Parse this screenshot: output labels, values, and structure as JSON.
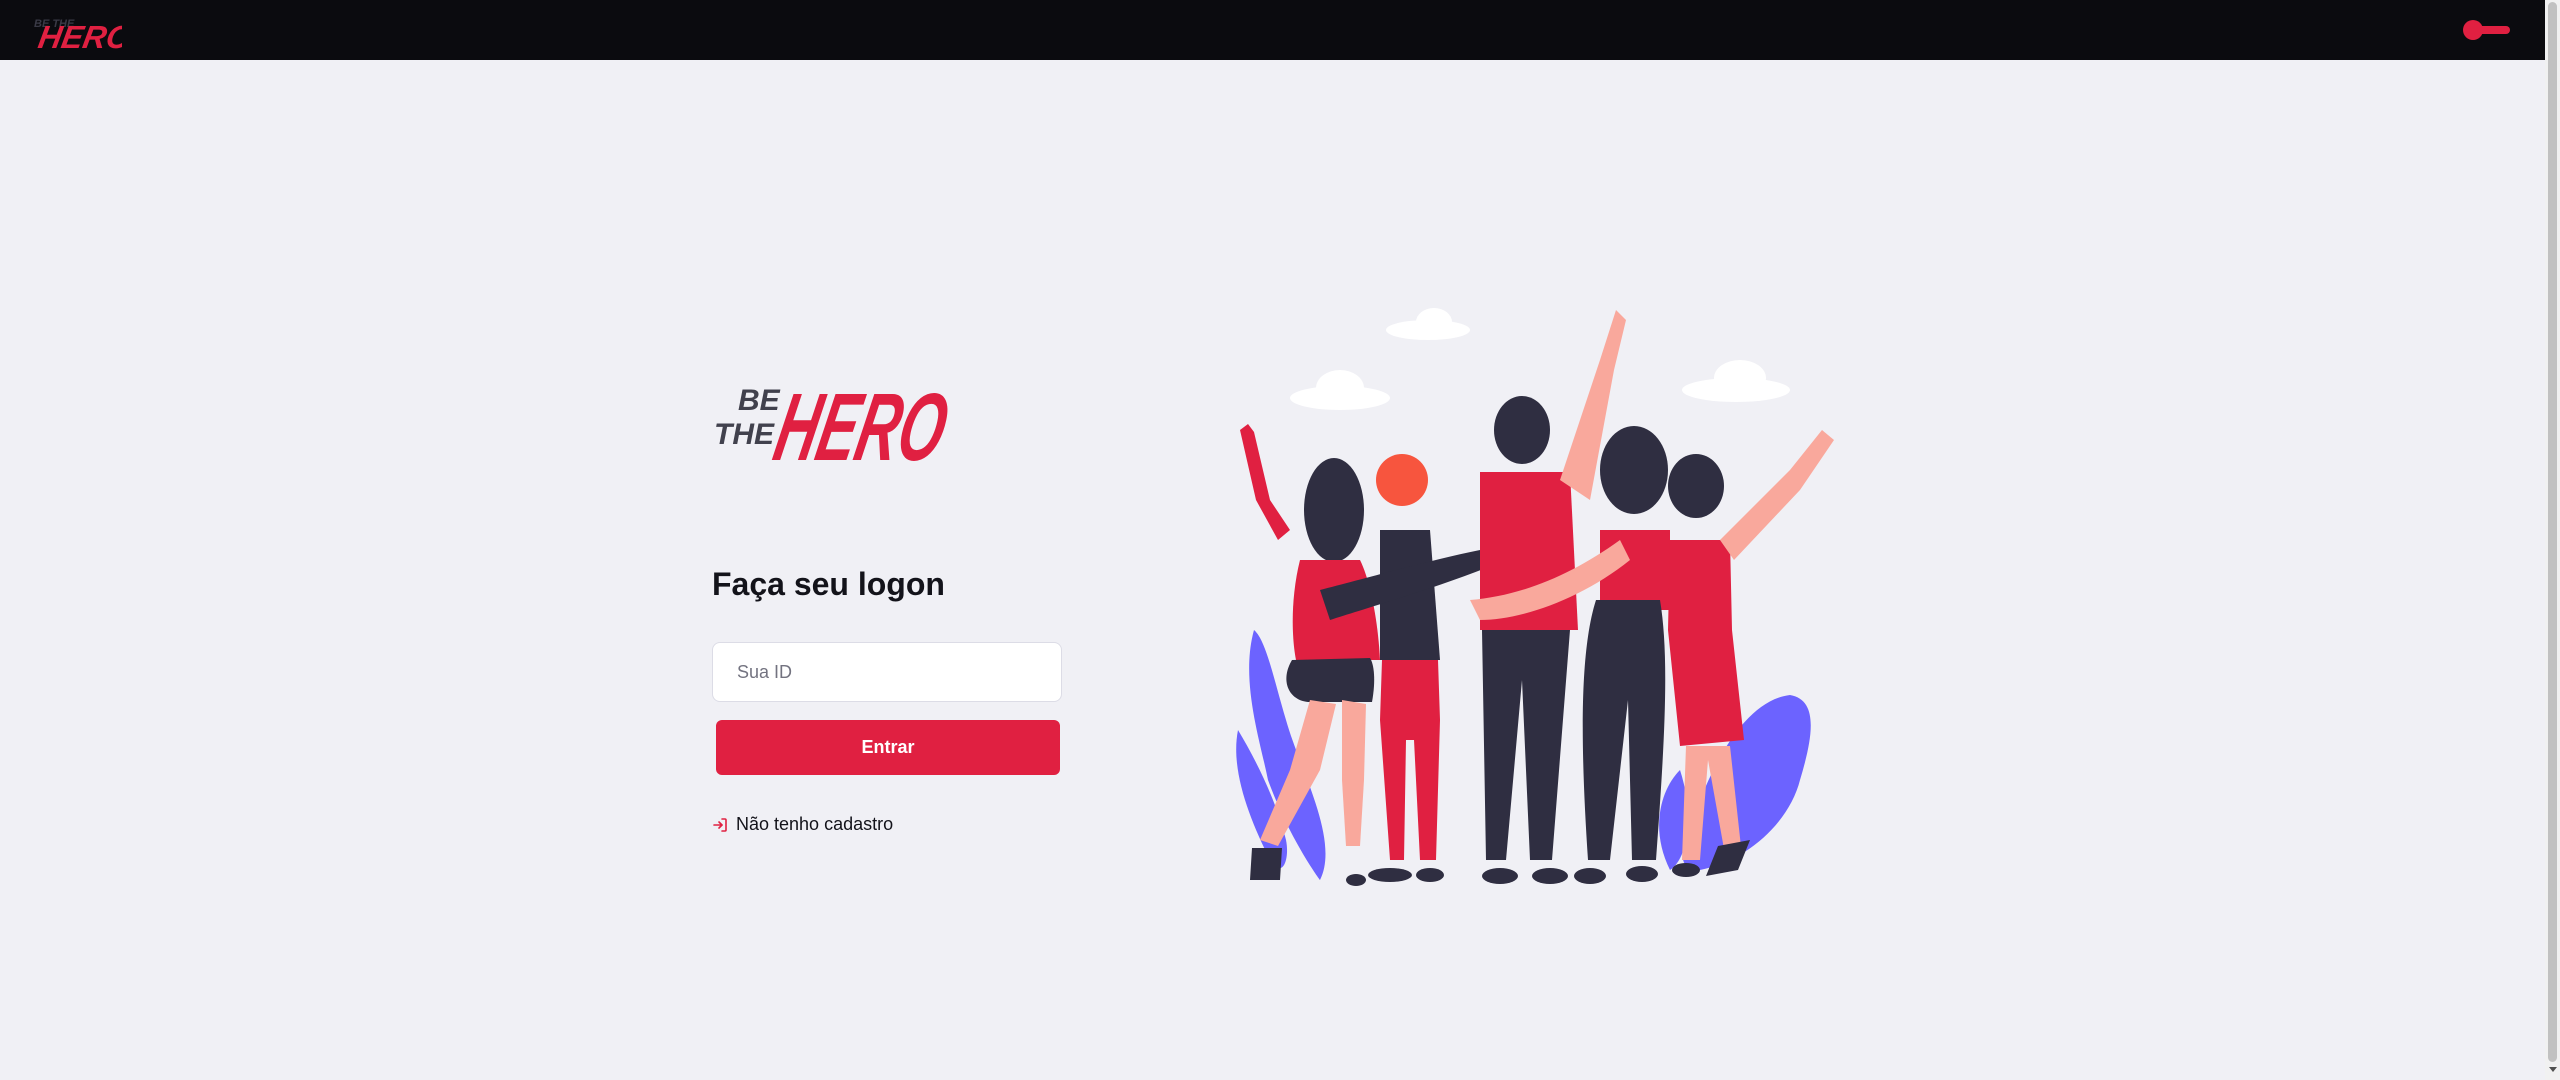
{
  "app": {
    "brand_top": "BE THE",
    "brand_main": "HERO"
  },
  "colors": {
    "accent": "#e02041",
    "topbar": "#0b0b0f",
    "background": "#f0f0f5",
    "text_dark": "#13131a",
    "illustration_purple": "#6c63ff",
    "skin": "#f9a89c",
    "black": "#2f2e41"
  },
  "header": {
    "theme_toggle_icon": "toggle-switch-icon"
  },
  "logon": {
    "title": "Faça seu logon",
    "id_placeholder": "Sua ID",
    "id_value": "",
    "submit_label": "Entrar",
    "register_label": "Não tenho cadastro",
    "register_icon": "log-in-icon"
  },
  "illustration": {
    "subject": "heroes-group-illustration"
  }
}
